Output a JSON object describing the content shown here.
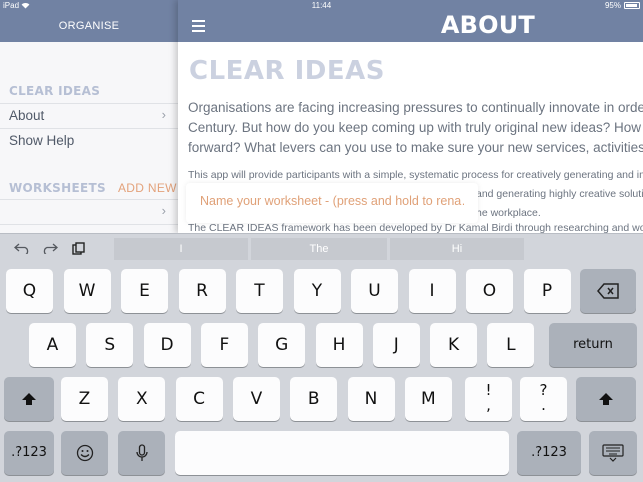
{
  "status_bar": {
    "device": "iPad",
    "wifi": "wifi-icon",
    "time": "11:44",
    "battery": "95%",
    "battery_level": 0.95
  },
  "sidebar": {
    "title": "ORGANISE",
    "section_clear": "CLEAR IDEAS",
    "items": [
      {
        "label": "About"
      },
      {
        "label": "Show Help"
      }
    ],
    "section_worksheets": "WORKSHEETS",
    "add_new": "ADD NEW"
  },
  "main": {
    "title": "ABOUT",
    "headline": "CLEAR IDEAS",
    "para1_lines": [
      "Organisations are facing increasing pressures to continually innovate in order to survive",
      "Century. But how do you keep coming up with truly original new ideas? How do you ch",
      "forward? What levers can you use to make sure your new services, activities or processe"
    ],
    "para2_lines": [
      "This app will provide participants with a simple, systematic process for creatively generating and imp",
      "and generating highly creative solution",
      "he workplace."
    ],
    "para3": "The CLEAR IDEAS framework has been developed by Dr Kamal Birdi through researching and working w"
  },
  "name_input": {
    "placeholder": "Name your worksheet - (press and hold to rena…"
  },
  "keyboard": {
    "shortcuts": {
      "undo": "undo-icon",
      "redo": "redo-icon",
      "paste": "paste-icon"
    },
    "suggestions": [
      "I",
      "The",
      "Hi"
    ],
    "row1": [
      "Q",
      "W",
      "E",
      "R",
      "T",
      "Y",
      "U",
      "I",
      "O",
      "P"
    ],
    "row2": [
      "A",
      "S",
      "D",
      "F",
      "G",
      "H",
      "J",
      "K",
      "L"
    ],
    "row3": [
      "Z",
      "X",
      "C",
      "V",
      "B",
      "N",
      "M"
    ],
    "row3_punct": [
      {
        "top": "!",
        "bottom": ","
      },
      {
        "top": "?",
        "bottom": "."
      }
    ],
    "return": "return",
    "numbers": ".?123",
    "backspace": "backspace-icon",
    "shift": "shift-icon",
    "emoji": "emoji-icon",
    "mic": "mic-icon",
    "dismiss": "keyboard-dismiss-icon"
  }
}
